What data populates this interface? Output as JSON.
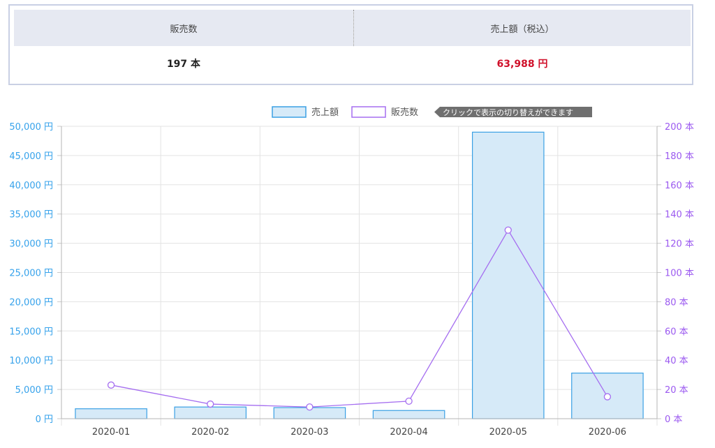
{
  "summary": {
    "sold_header": "販売数",
    "sales_header": "売上額（税込）",
    "sold_value": "197 本",
    "sales_value": "63,988 円"
  },
  "legend": {
    "hint": "クリックで表示の切り替えができます"
  },
  "colors": {
    "bar_fill": "#d6eaf8",
    "bar_stroke": "#3aa0e4",
    "left_axis": "#36a2eb",
    "line": "#a56ef0",
    "right_axis": "#9b59f0",
    "grid": "#e3e3e3",
    "sales_value": "#d0102a"
  },
  "chart_data": {
    "type": "bar",
    "categories": [
      "2020-01",
      "2020-02",
      "2020-03",
      "2020-04",
      "2020-05",
      "2020-06"
    ],
    "series": [
      {
        "name": "売上額",
        "type": "bar",
        "axis": "left",
        "values": [
          1700,
          2000,
          1900,
          1400,
          49000,
          7800
        ]
      },
      {
        "name": "販売数",
        "type": "line",
        "axis": "right",
        "values": [
          23,
          10,
          8,
          12,
          129,
          15
        ]
      }
    ],
    "y_left": {
      "min": 0,
      "max": 50000,
      "ticks": [
        "0 円",
        "5,000 円",
        "10,000 円",
        "15,000 円",
        "20,000 円",
        "25,000 円",
        "30,000 円",
        "35,000 円",
        "40,000 円",
        "45,000 円",
        "50,000 円"
      ]
    },
    "y_right": {
      "min": 0,
      "max": 200,
      "ticks": [
        "0 本",
        "20 本",
        "40 本",
        "60 本",
        "80 本",
        "100 本",
        "120 本",
        "140 本",
        "160 本",
        "180 本",
        "200 本"
      ]
    },
    "legend_position": "top",
    "grid": true
  }
}
